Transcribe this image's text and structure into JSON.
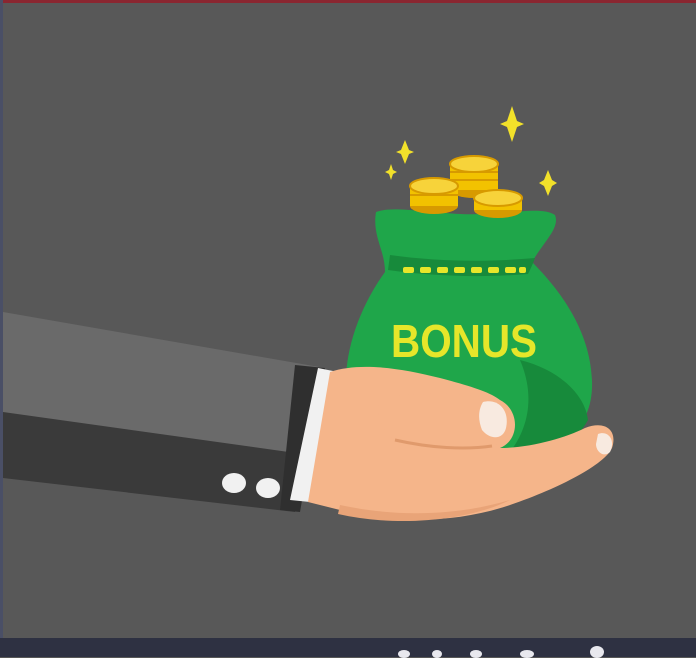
{
  "image": {
    "bag_label": "BONUS",
    "colors": {
      "background": "#585858",
      "bag": "#1fa64a",
      "bag_shade": "#178a3b",
      "label": "#e6e62a",
      "coin": "#f2c200",
      "coin_edge": "#d79a00",
      "sparkle": "#f2e12a",
      "skin": "#f5b58a",
      "sleeve": "#6a6a6a",
      "sleeve_dark": "#3a3a3a",
      "cuff": "#f1f1f1"
    }
  }
}
